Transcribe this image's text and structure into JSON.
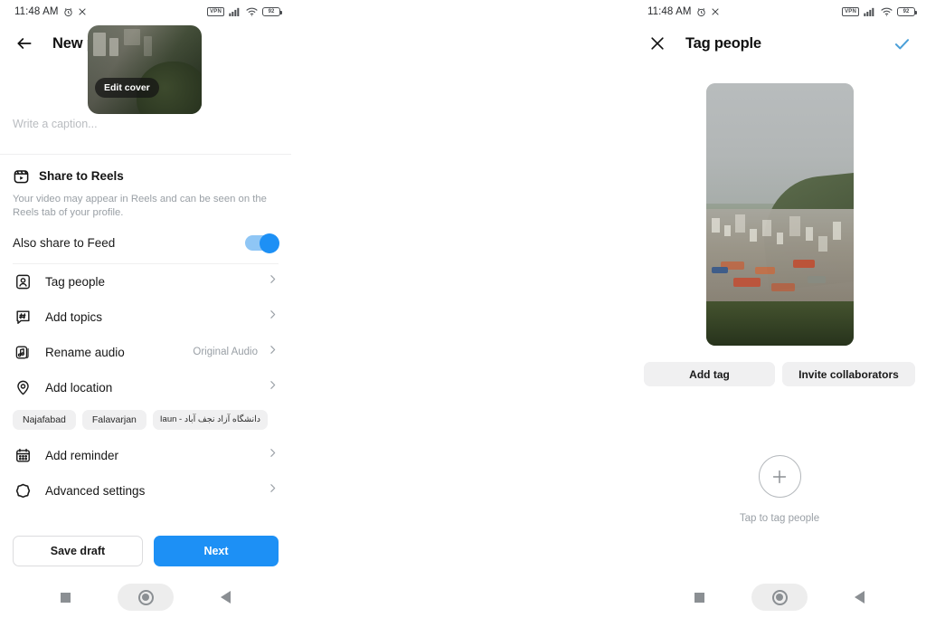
{
  "status_bar": {
    "time": "11:48 AM",
    "left_icons": [
      "alarm-icon",
      "close-icon"
    ],
    "right_icons": [
      "vpn-icon",
      "signal-icon",
      "wifi-icon",
      "battery-icon"
    ],
    "vpn_label": "VPN",
    "battery_level": "92"
  },
  "left_screen": {
    "appbar": {
      "back_icon": "arrow-left-icon",
      "title": "New post"
    },
    "cover": {
      "edit_label": "Edit cover"
    },
    "caption": {
      "placeholder": "Write a caption...",
      "value": ""
    },
    "reels": {
      "icon": "reels-icon",
      "title": "Share to Reels",
      "description": "Your video may appear in Reels and can be seen on the Reels tab of your profile.",
      "feed_toggle_label": "Also share to Feed",
      "feed_toggle_state": "on"
    },
    "menu": [
      {
        "icon": "tag-people-icon",
        "label": "Tag people",
        "value": ""
      },
      {
        "icon": "hashtag-icon",
        "label": "Add topics",
        "value": ""
      },
      {
        "icon": "audio-note-icon",
        "label": "Rename audio",
        "value": "Original Audio"
      },
      {
        "icon": "location-pin-icon",
        "label": "Add location",
        "value": ""
      }
    ],
    "location_chips": [
      "Najafabad",
      "Falavarjan",
      "دانشگاه آزاد نجف آباد - Iaun"
    ],
    "menu_after_chips": [
      {
        "icon": "calendar-icon",
        "label": "Add reminder",
        "value": ""
      },
      {
        "icon": "advanced-settings-icon",
        "label": "Advanced settings",
        "value": ""
      }
    ],
    "buttons": {
      "save_draft": "Save draft",
      "next": "Next"
    }
  },
  "right_screen": {
    "appbar": {
      "close_icon": "close-icon",
      "title": "Tag people",
      "confirm_icon": "check-icon"
    },
    "pills": {
      "add_tag": "Add tag",
      "invite_collaborators": "Invite collaborators"
    },
    "empty_state": {
      "icon": "plus-circle-icon",
      "label": "Tap to tag people"
    }
  },
  "nav_bar": {
    "recents_icon": "square-icon",
    "home_icon": "circle-icon",
    "back_icon": "triangle-back-icon"
  },
  "colors": {
    "accent_blue": "#1d90f5",
    "toggle_track": "#8fc6f5",
    "confirm_check": "#4a9fd8",
    "chip_bg": "#f0f0f1",
    "muted_text": "#9aa0a6"
  }
}
